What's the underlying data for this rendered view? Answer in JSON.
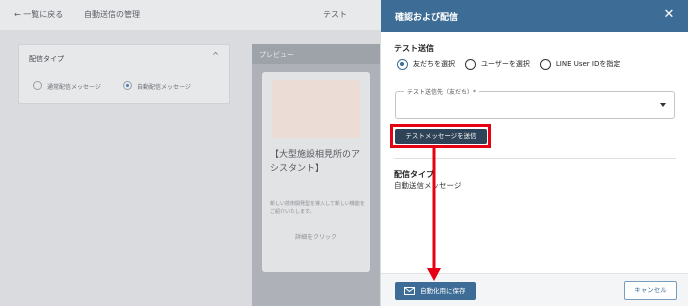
{
  "background": {
    "top_items": [
      "← 一覧に戻る",
      "自動送信の管理",
      "テスト"
    ],
    "panel_title": "配信タイプ",
    "radio_options": [
      "通常配信メッセージ",
      "自動配信メッセージ"
    ],
    "preview_label": "プレビュー",
    "card_title": "【大型施設相見所のアシスタント】",
    "card_description": "新しい技術開発型を導入して新しい機能をご紹介いたします。",
    "card_button": "詳細をクリック"
  },
  "modal": {
    "title": "確認および配信",
    "close": "✕",
    "test_send": {
      "label": "テスト送信",
      "options": [
        "友だちを選択",
        "ユーザーを選択",
        "LINE User IDを指定"
      ],
      "selected_index": 0,
      "select_label": "テスト送信先（友だち）*",
      "button": "テストメッセージを送信"
    },
    "delivery": {
      "label": "配信タイプ",
      "value": "自動送信メッセージ"
    },
    "footer": {
      "save": "自動化用に保存",
      "cancel": "キャンセル"
    }
  },
  "colors": {
    "header": "#3d6d96",
    "highlight": "#e60012",
    "test_button": "#2e4357"
  }
}
